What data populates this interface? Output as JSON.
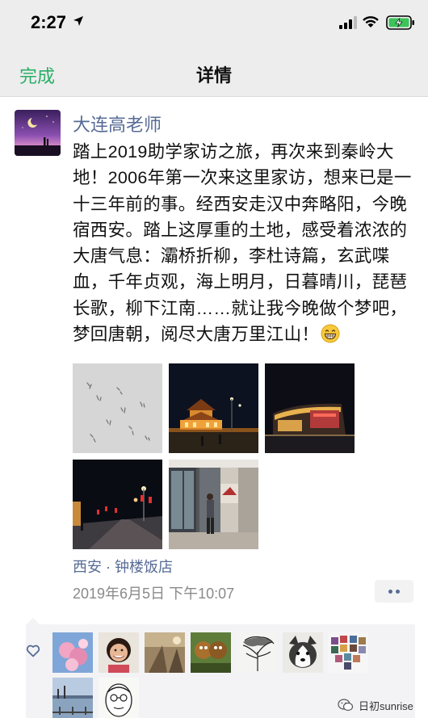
{
  "status_bar": {
    "time": "2:27"
  },
  "nav": {
    "done_label": "完成",
    "title": "详情"
  },
  "post": {
    "author": "大连高老师",
    "text": "踏上2019助学家访之旅，再次来到秦岭大地！2006年第一次来这里家访，想来已是一十三年前的事。经西安走汉中奔略阳，今晚宿西安。踏上这厚重的土地，感受着浓浓的大唐气息：灞桥折柳，李杜诗篇，玄武喋血，千年贞观，海上明月，日暮晴川，琵琶长歌，柳下江南……就让我今晚做个梦吧，梦回唐朝，阅尽大唐万里江山！",
    "emoji": "grinning-face-icon",
    "location": "西安 · 钟楼饭店",
    "timestamp": "2019年6月5日 下午10:07",
    "photo_count": 5
  },
  "likes": {
    "count": 9
  },
  "watermark": {
    "text": "日初sunrise"
  },
  "colors": {
    "accent_green": "#2aae67",
    "link_blue": "#576b95",
    "nav_bg": "#ededed",
    "likes_bg": "#f3f3f5"
  }
}
